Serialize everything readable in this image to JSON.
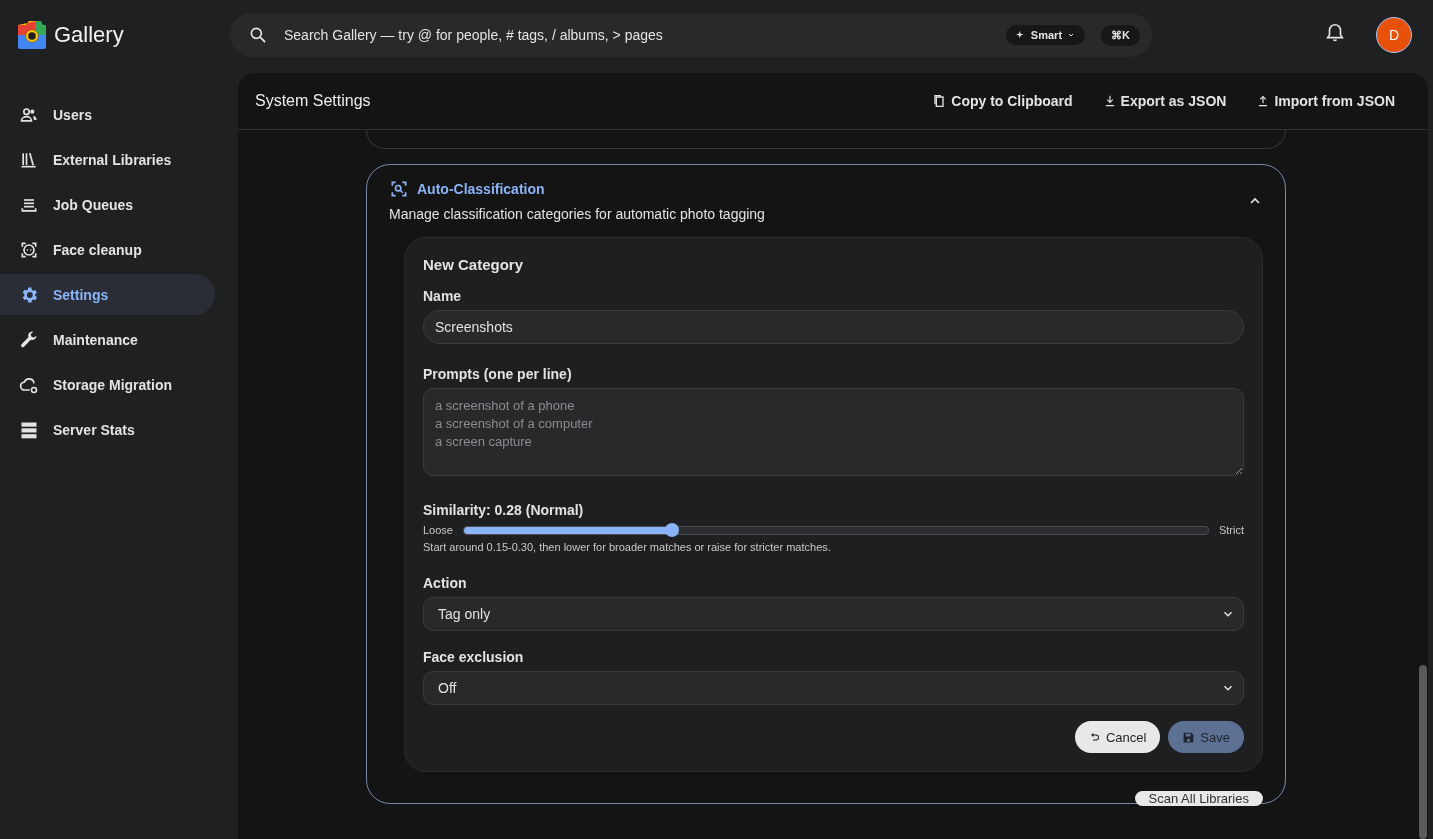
{
  "app": {
    "name": "Gallery"
  },
  "search": {
    "placeholder": "Search Gallery — try @ for people, # tags, / albums, > pages",
    "mode": "Smart",
    "shortcut": "⌘K"
  },
  "avatar": {
    "initial": "D"
  },
  "sidebar": {
    "items": [
      {
        "label": "Users",
        "selected": false
      },
      {
        "label": "External Libraries",
        "selected": false
      },
      {
        "label": "Job Queues",
        "selected": false
      },
      {
        "label": "Face cleanup",
        "selected": false
      },
      {
        "label": "Settings",
        "selected": true
      },
      {
        "label": "Maintenance",
        "selected": false
      },
      {
        "label": "Storage Migration",
        "selected": false
      },
      {
        "label": "Server Stats",
        "selected": false
      }
    ]
  },
  "page": {
    "title": "System Settings",
    "actions": [
      "Copy to Clipboard",
      "Export as JSON",
      "Import from JSON"
    ]
  },
  "section": {
    "title": "Auto-Classification",
    "description": "Manage classification categories for automatic photo tagging",
    "expanded": true,
    "form": {
      "title": "New Category",
      "name": {
        "label": "Name",
        "value": "Screenshots"
      },
      "prompts": {
        "label": "Prompts (one per line)",
        "placeholder": "a screenshot of a phone\na screenshot of a computer\na screen capture"
      },
      "similarity": {
        "label": "Similarity: 0.28 (Normal)",
        "min_label": "Loose",
        "max_label": "Strict",
        "level": 0.28,
        "hint": "Start around 0.15-0.30, then lower for broader matches or raise for stricter matches."
      },
      "action": {
        "label": "Action",
        "value": "Tag only"
      },
      "face_exclusion": {
        "label": "Face exclusion",
        "value": "Off"
      },
      "buttons": [
        "Cancel",
        "Save"
      ]
    },
    "scan_button": "Scan All Libraries"
  }
}
